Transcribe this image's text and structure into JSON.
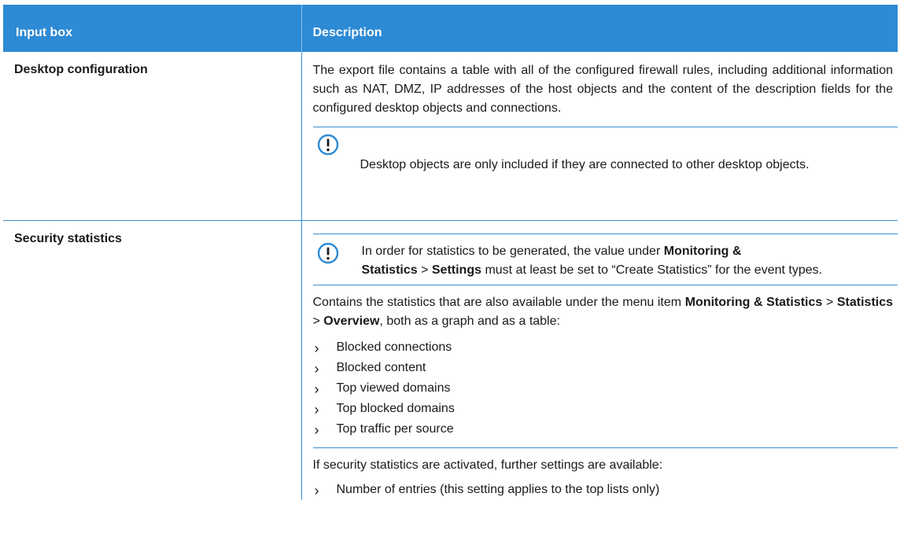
{
  "header": {
    "col1": "Input box",
    "col2": "Description"
  },
  "rows": [
    {
      "label": "Desktop configuration",
      "paragraph": "The export file contains a table with all of the configured firewall rules, including additional information such as NAT, DMZ, IP addresses of the host objects and the content of the description fields for the configured desktop objects and connections.",
      "note": "Desktop objects are only included if they are connected to other desktop objects."
    },
    {
      "label": "Security statistics",
      "note": {
        "t1": "In order for statistics to be generated, the value under ",
        "b1": "Monitoring &",
        "b2": "Statistics",
        "sep": " > ",
        "b3": "Settings",
        "t2": " must at least be set to “Create Statistics” for the event types."
      },
      "para2": {
        "t1": "Contains the statistics that are also available under the menu item ",
        "b1": "Monitoring &",
        "b2": "Statistics",
        "sep1": " > ",
        "b3": "Statistics",
        "sep2": " > ",
        "b4": "Overview",
        "t2": ", both as a graph and as a table:"
      },
      "list1": [
        "Blocked connections",
        "Blocked content",
        "Top viewed domains",
        "Top blocked domains",
        "Top traffic per source"
      ],
      "para3": "If security statistics are activated, further settings are available:",
      "list2": [
        "Number of entries (this setting applies to the top lists only)"
      ]
    }
  ],
  "colors": {
    "header_bg": "#2d8ad4",
    "rule": "#3b8fd0",
    "icon": "#2d8ad4"
  },
  "icons": {
    "note": "exclamation-circle-icon",
    "bullet": "chevron-right-icon"
  }
}
